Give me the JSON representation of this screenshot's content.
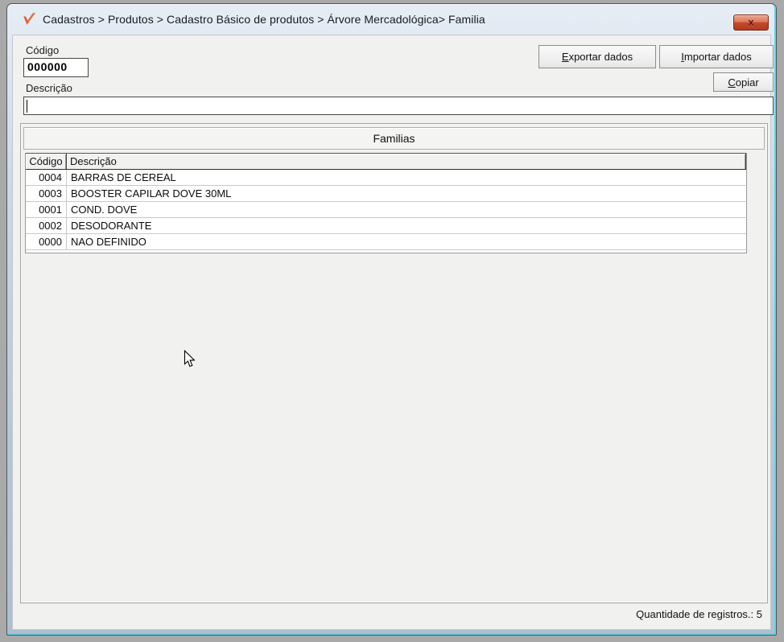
{
  "window": {
    "title": "Cadastros > Produtos > Cadastro Básico de produtos > Árvore Mercadológica> Familia",
    "close_glyph": "x"
  },
  "form": {
    "codigo_label": "Código",
    "codigo_value": "000000",
    "descricao_label": "Descrição",
    "descricao_value": "",
    "buttons": {
      "exportar": {
        "mnemonic": "E",
        "rest": "xportar dados"
      },
      "importar": {
        "mnemonic": "I",
        "rest": "mportar dados"
      },
      "copiar": {
        "mnemonic": "C",
        "rest": "opiar"
      }
    }
  },
  "panel": {
    "title": "Familias",
    "table": {
      "columns": {
        "codigo": "Código",
        "descricao": "Descrição"
      },
      "rows": [
        {
          "codigo": "0004",
          "descricao": "BARRAS DE CEREAL"
        },
        {
          "codigo": "0003",
          "descricao": "BOOSTER CAPILAR DOVE 30ML"
        },
        {
          "codigo": "0001",
          "descricao": "COND. DOVE"
        },
        {
          "codigo": "0002",
          "descricao": "DESODORANTE"
        },
        {
          "codigo": "0000",
          "descricao": "NAO DEFINIDO"
        }
      ]
    }
  },
  "status": {
    "record_count_text": "Quantidade de registros.: 5"
  },
  "colors": {
    "brand_orange": "#e8602c",
    "close_button_red": "#b03a20",
    "frame_blue": "#c2d0de",
    "accent_cyan": "#5fd6e8",
    "client_bg": "#f1f1f0"
  }
}
